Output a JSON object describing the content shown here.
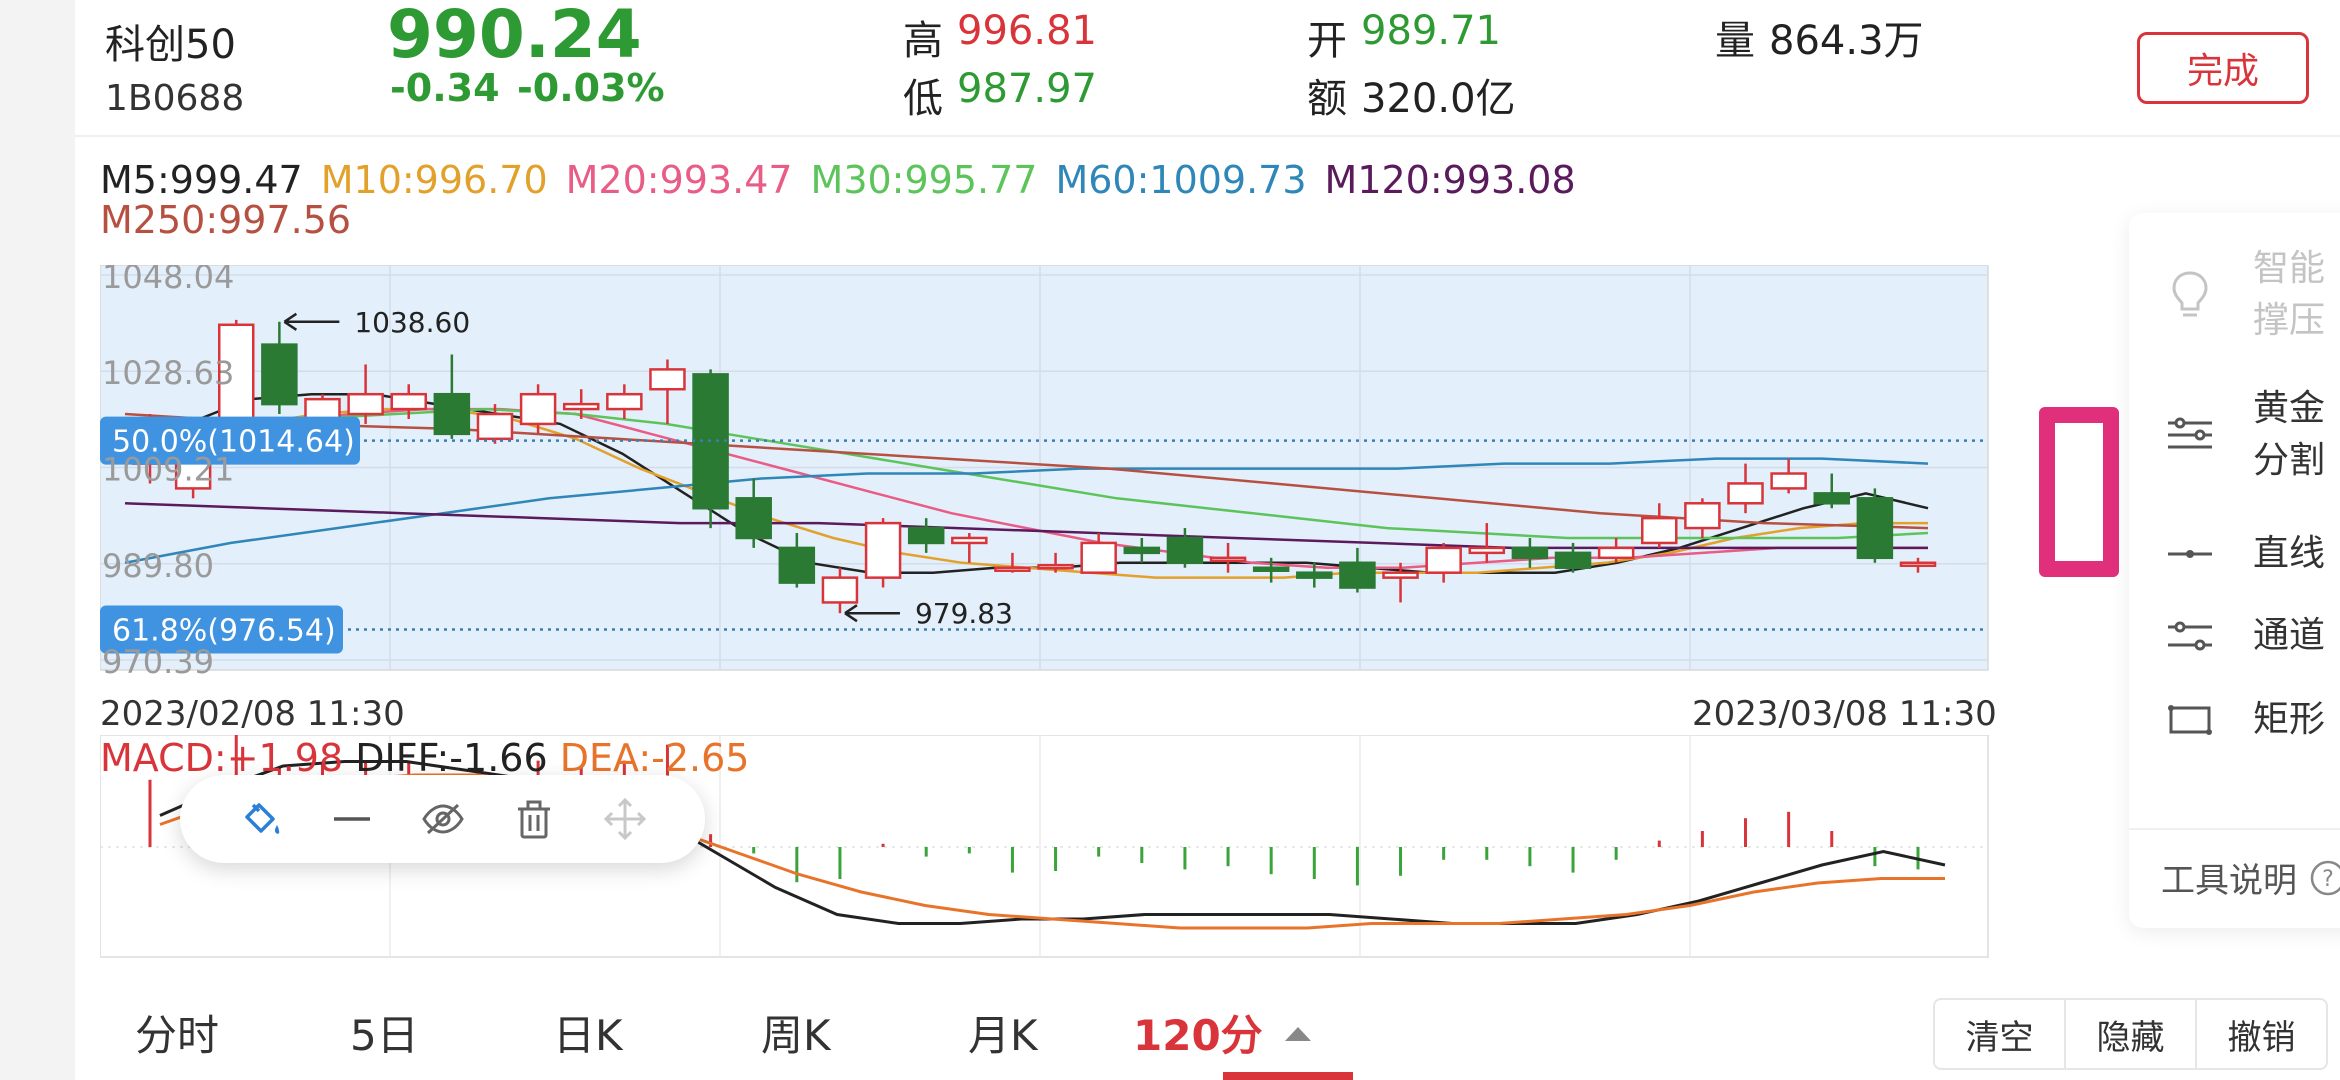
{
  "header": {
    "stock_name": "科创50",
    "stock_code": "1B0688",
    "price": "990.24",
    "change": "-0.34",
    "change_pct": "-0.03%",
    "high_label": "高",
    "high_value": "996.81",
    "low_label": "低",
    "low_value": "987.97",
    "open_label": "开",
    "open_value": "989.71",
    "amount_label": "额",
    "amount_value": "320.0亿",
    "volume_label": "量",
    "volume_value": "864.3万",
    "done_button": "完成"
  },
  "ma_legend": [
    {
      "text": "M5:999.47",
      "color": "#222222"
    },
    {
      "text": "M10:996.70",
      "color": "#e2a12a"
    },
    {
      "text": "M20:993.47",
      "color": "#e85c86"
    },
    {
      "text": "M30:995.77",
      "color": "#5cc45a"
    },
    {
      "text": "M60:1009.73",
      "color": "#2f86b8"
    },
    {
      "text": "M120:993.08",
      "color": "#5b1a5c"
    },
    {
      "text": "M250:997.56",
      "color": "#b65142"
    }
  ],
  "chart_data": {
    "type": "candlestick",
    "y_ticks": [
      "1048.04",
      "1028.63",
      "1009.21",
      "989.80",
      "970.39"
    ],
    "ylim": [
      970.39,
      1048.04
    ],
    "x_start_label": "2023/02/08 11:30",
    "x_end_label": "2023/03/08 11:30",
    "max_annotation": "1038.60",
    "min_annotation": "979.83",
    "fib_levels": [
      {
        "label": "50.0%(1014.64)",
        "value": 1014.64
      },
      {
        "label": "61.8%(976.54)",
        "value": 976.54
      }
    ],
    "candles": [
      {
        "o": 1010,
        "c": 1018,
        "h": 1020,
        "l": 1006
      },
      {
        "o": 1005,
        "c": 1012,
        "h": 1014,
        "l": 1003
      },
      {
        "o": 1018,
        "c": 1038,
        "h": 1039,
        "l": 1016
      },
      {
        "o": 1034,
        "c": 1022,
        "h": 1038.6,
        "l": 1020
      },
      {
        "o": 1018,
        "c": 1023,
        "h": 1024,
        "l": 1016
      },
      {
        "o": 1020,
        "c": 1024,
        "h": 1030,
        "l": 1018
      },
      {
        "o": 1021,
        "c": 1024,
        "h": 1026,
        "l": 1019
      },
      {
        "o": 1024,
        "c": 1016,
        "h": 1032,
        "l": 1015
      },
      {
        "o": 1015,
        "c": 1020,
        "h": 1022,
        "l": 1014
      },
      {
        "o": 1018,
        "c": 1024,
        "h": 1026,
        "l": 1016
      },
      {
        "o": 1021,
        "c": 1022,
        "h": 1025,
        "l": 1019
      },
      {
        "o": 1021,
        "c": 1024,
        "h": 1026,
        "l": 1019
      },
      {
        "o": 1025,
        "c": 1029,
        "h": 1031,
        "l": 1018
      },
      {
        "o": 1028,
        "c": 1001,
        "h": 1029,
        "l": 997
      },
      {
        "o": 1003,
        "c": 995,
        "h": 1007,
        "l": 993
      },
      {
        "o": 993,
        "c": 986,
        "h": 996,
        "l": 985
      },
      {
        "o": 982,
        "c": 987,
        "h": 989,
        "l": 979.83
      },
      {
        "o": 987,
        "c": 998,
        "h": 999,
        "l": 985
      },
      {
        "o": 997,
        "c": 994,
        "h": 999,
        "l": 992
      },
      {
        "o": 994,
        "c": 995,
        "h": 996,
        "l": 990
      },
      {
        "o": 989,
        "c": 989,
        "h": 992,
        "l": 988
      },
      {
        "o": 989,
        "c": 989.5,
        "h": 992,
        "l": 988
      },
      {
        "o": 988,
        "c": 994,
        "h": 996,
        "l": 988
      },
      {
        "o": 993,
        "c": 992,
        "h": 995,
        "l": 990
      },
      {
        "o": 995,
        "c": 990,
        "h": 997,
        "l": 989
      },
      {
        "o": 991,
        "c": 991,
        "h": 994,
        "l": 988
      },
      {
        "o": 989,
        "c": 988.5,
        "h": 991,
        "l": 986
      },
      {
        "o": 988,
        "c": 987,
        "h": 990,
        "l": 985
      },
      {
        "o": 990,
        "c": 985,
        "h": 993,
        "l": 984
      },
      {
        "o": 987,
        "c": 988,
        "h": 990,
        "l": 982
      },
      {
        "o": 988,
        "c": 993,
        "h": 994,
        "l": 986
      },
      {
        "o": 992,
        "c": 993,
        "h": 998,
        "l": 990
      },
      {
        "o": 993,
        "c": 991,
        "h": 995,
        "l": 989
      },
      {
        "o": 992,
        "c": 989,
        "h": 994,
        "l": 988
      },
      {
        "o": 991,
        "c": 993,
        "h": 995,
        "l": 990
      },
      {
        "o": 994,
        "c": 999,
        "h": 1002,
        "l": 993
      },
      {
        "o": 997,
        "c": 1002,
        "h": 1003,
        "l": 995
      },
      {
        "o": 1002,
        "c": 1006,
        "h": 1010,
        "l": 1000
      },
      {
        "o": 1005,
        "c": 1008,
        "h": 1011,
        "l": 1004
      },
      {
        "o": 1004,
        "c": 1002,
        "h": 1008,
        "l": 1001
      },
      {
        "o": 1003,
        "c": 991,
        "h": 1005,
        "l": 990
      },
      {
        "o": 990,
        "c": 990,
        "h": 991,
        "l": 988
      }
    ],
    "ma_series": [
      {
        "name": "M5",
        "color": "#222222",
        "values": [
          1012,
          1018,
          1023,
          1024,
          1024,
          1022,
          1020,
          1018,
          1012,
          1004,
          996,
          990,
          988,
          988,
          989,
          989,
          990,
          990,
          990,
          990,
          989,
          988,
          988,
          988,
          990,
          993,
          997,
          1001,
          1004,
          1001
        ]
      },
      {
        "name": "M10",
        "color": "#e2a12a",
        "values": [
          1010,
          1015,
          1018,
          1020,
          1021,
          1021,
          1019,
          1015,
          1009,
          1004,
          999,
          995,
          992,
          990,
          989,
          988,
          987,
          987,
          987,
          988,
          988,
          988,
          989,
          990,
          992,
          995,
          997,
          998,
          998
        ]
      },
      {
        "name": "M20",
        "color": "#e85c86",
        "values": [
          1012,
          1016,
          1018,
          1020,
          1021,
          1021,
          1020,
          1016,
          1012,
          1008,
          1004,
          1000,
          997,
          994,
          992,
          990,
          989,
          989,
          990,
          991,
          991,
          992,
          993,
          993,
          993
        ]
      },
      {
        "name": "M30",
        "color": "#5cc45a",
        "values": [
          1015,
          1018,
          1019,
          1020,
          1021,
          1020,
          1018,
          1015,
          1012,
          1009,
          1006,
          1003,
          1001,
          999,
          997,
          996,
          995,
          995,
          995,
          995,
          996
        ]
      },
      {
        "name": "M60",
        "color": "#2f86b8",
        "values": [
          990,
          994,
          997,
          1000,
          1003,
          1005,
          1007,
          1008,
          1008,
          1009,
          1009,
          1009,
          1009,
          1010,
          1010,
          1011,
          1011,
          1010
        ]
      },
      {
        "name": "M120",
        "color": "#5b1a5c",
        "values": [
          1002,
          1001,
          1000,
          999,
          998,
          998,
          997,
          996,
          995,
          994,
          993,
          993,
          993,
          993
        ]
      },
      {
        "name": "M250",
        "color": "#b65142",
        "values": [
          1020,
          1018,
          1017,
          1015,
          1013,
          1011,
          1009,
          1006,
          1003,
          1000,
          998,
          997
        ]
      }
    ],
    "macd": {
      "macd_label": "MACD:+1.98",
      "diff_label": "DIFF:-1.66",
      "dea_label": "DEA:-2.65"
    }
  },
  "float_toolbar": {
    "icons": [
      "paint-bucket-icon",
      "line-style-icon",
      "eye-off-icon",
      "trash-icon",
      "move-icon"
    ]
  },
  "side_panel": {
    "items": [
      {
        "label": "智能撑压",
        "icon": "lightbulb-icon",
        "disabled": true
      },
      {
        "label": "黄金分割",
        "icon": "golden-section-icon",
        "disabled": false
      },
      {
        "label": "直线",
        "icon": "line-icon",
        "disabled": false
      },
      {
        "label": "通道",
        "icon": "channel-icon",
        "disabled": false
      },
      {
        "label": "矩形",
        "icon": "rectangle-icon",
        "disabled": false
      }
    ],
    "tool_desc": "工具说明"
  },
  "bottom_tabs": [
    "分时",
    "5日",
    "日K",
    "周K",
    "月K",
    "120分"
  ],
  "active_tab": "120分",
  "actions": [
    "清空",
    "隐藏",
    "撤销"
  ]
}
